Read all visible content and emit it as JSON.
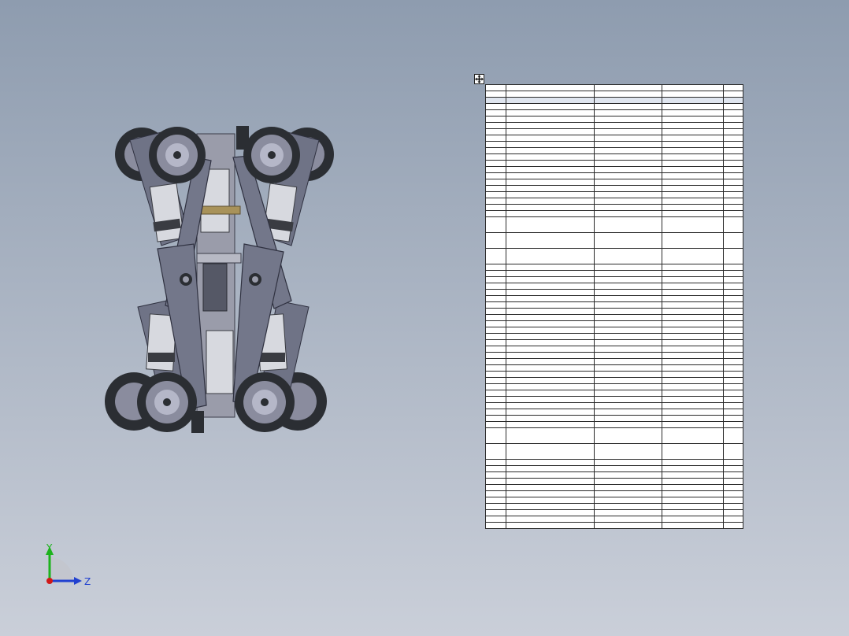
{
  "viewport": {
    "background_top": "#8e9caf",
    "background_bottom": "#cacfd9"
  },
  "triad": {
    "y_label": "Y",
    "z_label": "Z"
  },
  "bom": {
    "headers": [
      "",
      "",
      "",
      "",
      ""
    ],
    "row_count": 62,
    "tall_rows": [
      20,
      21,
      22,
      49,
      50
    ],
    "highlight_row": 1,
    "colors": {
      "grid": "#2a2a2a",
      "highlight": "#dfe5ef"
    }
  },
  "model": {
    "colors": {
      "tire": "#2b2e33",
      "hub": "#8a8c9e",
      "hub_face": "#b5b7c8",
      "frame": "#6f7386",
      "frame_dark": "#4a4d5c",
      "motor": "#d7d9df",
      "motor_dark": "#3a3c42",
      "brass": "#a8925a"
    }
  }
}
